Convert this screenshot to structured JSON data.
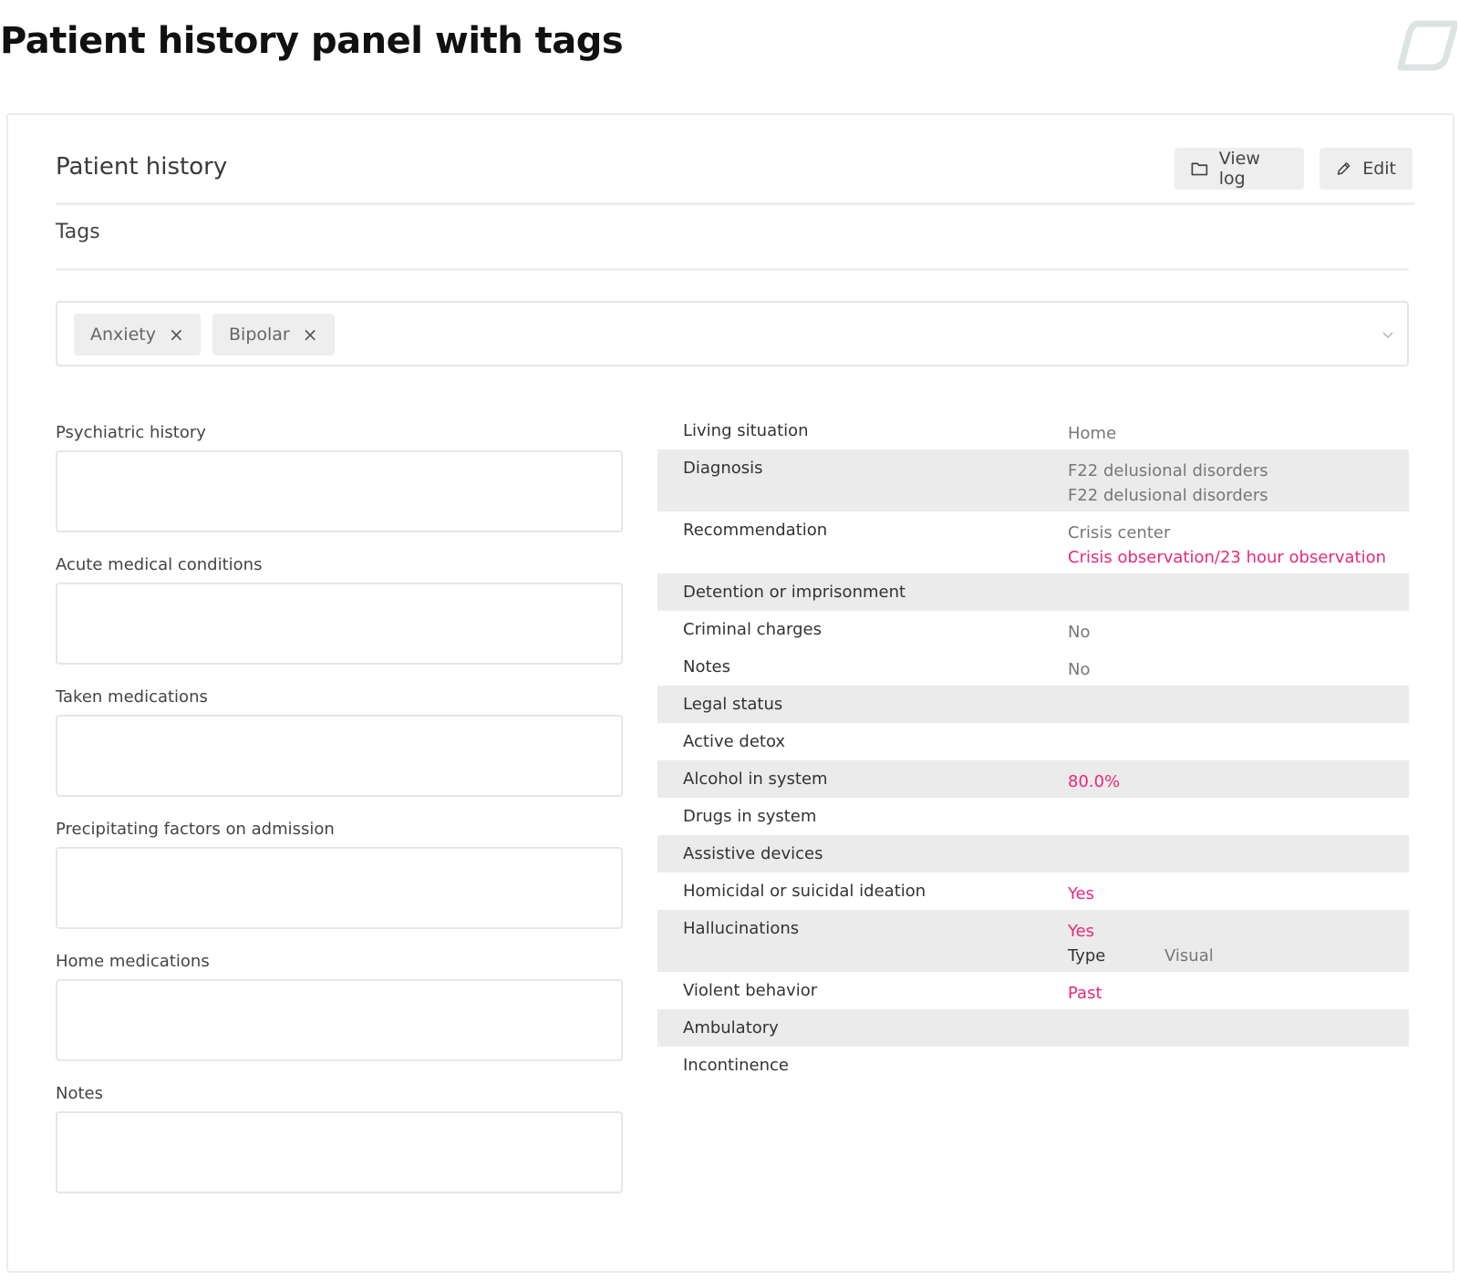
{
  "page": {
    "title": "Patient history panel with tags"
  },
  "panel": {
    "title": "Patient history",
    "view_log_label": "View log",
    "edit_label": "Edit",
    "tags_section_label": "Tags",
    "tags": [
      {
        "label": "Anxiety",
        "remove": "×"
      },
      {
        "label": "Bipolar",
        "remove": "×"
      }
    ]
  },
  "fields": [
    {
      "label": "Psychiatric history",
      "value": ""
    },
    {
      "label": "Acute medical conditions",
      "value": ""
    },
    {
      "label": "Taken medications",
      "value": ""
    },
    {
      "label": "Precipitating factors on admission",
      "value": ""
    },
    {
      "label": "Home medications",
      "value": ""
    },
    {
      "label": "Notes",
      "value": ""
    }
  ],
  "info": {
    "living_situation": {
      "label": "Living situation",
      "value": "Home"
    },
    "diagnosis": {
      "label": "Diagnosis",
      "value1": "F22 delusional disorders",
      "value2": "F22 delusional disorders"
    },
    "recommendation": {
      "label": "Recommendation",
      "value1": "Crisis center",
      "value2": "Crisis observation/23 hour observation"
    },
    "detention": {
      "label": "Detention or imprisonment"
    },
    "criminal_charges": {
      "label": "Criminal charges",
      "value": "No"
    },
    "notes": {
      "label": "Notes",
      "value": "No"
    },
    "legal_status": {
      "label": "Legal status"
    },
    "active_detox": {
      "label": "Active detox"
    },
    "alcohol": {
      "label": "Alcohol in system",
      "value": "80.0%"
    },
    "drugs": {
      "label": "Drugs in system"
    },
    "assistive": {
      "label": "Assistive devices"
    },
    "ideation": {
      "label": "Homicidal or suicidal ideation",
      "value": "Yes"
    },
    "hallucinations": {
      "label": "Hallucinations",
      "value": "Yes",
      "type_label": "Type",
      "type_value": "Visual"
    },
    "violent": {
      "label": "Violent behavior",
      "value": "Past"
    },
    "ambulatory": {
      "label": "Ambulatory"
    },
    "incontinence": {
      "label": "Incontinence"
    }
  },
  "colors": {
    "accent": "#e8297a",
    "shade": "#ebebeb",
    "border": "#e6e6e6"
  },
  "icons": {
    "view_log": "folder-icon",
    "edit": "pencil-icon",
    "tag_remove": "close-icon",
    "dropdown": "chevron-down-icon"
  }
}
